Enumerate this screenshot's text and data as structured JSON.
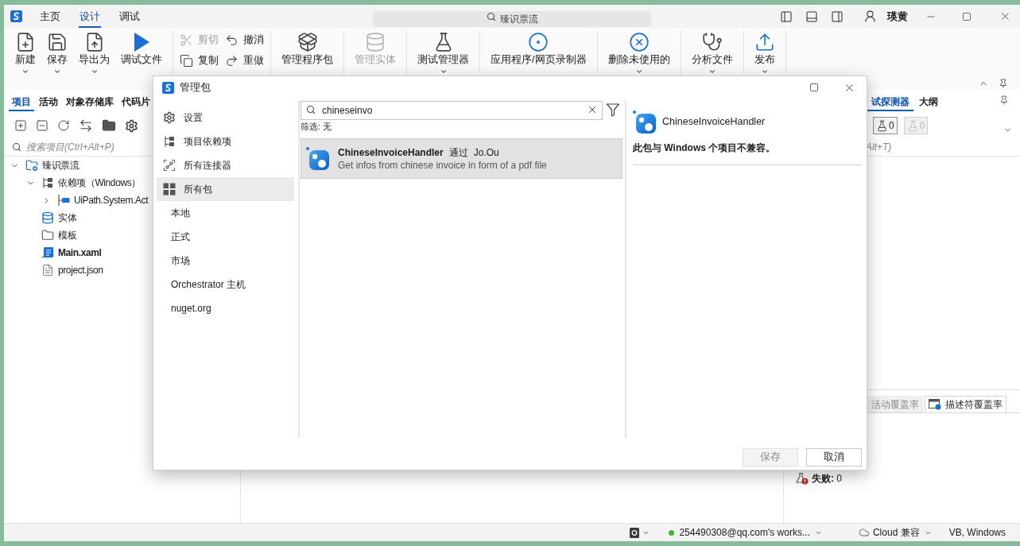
{
  "title_bar": {
    "tabs": [
      {
        "label": "主页",
        "selected": false
      },
      {
        "label": "设计",
        "selected": true
      },
      {
        "label": "调试",
        "selected": false
      }
    ],
    "search": {
      "placeholder": "臻识票流"
    },
    "user": "瑛黄"
  },
  "ribbon": [
    {
      "buttons": [
        {
          "kind": "large",
          "label": "新建",
          "dropdown": true,
          "disabled": false
        },
        {
          "kind": "large",
          "label": "保存",
          "dropdown": true,
          "disabled": false
        },
        {
          "kind": "large",
          "label": "导出为",
          "dropdown": true,
          "disabled": false
        },
        {
          "kind": "large",
          "label": "调试文件",
          "dropdown": false,
          "disabled": false
        }
      ]
    },
    {
      "buttons": [
        {
          "kind": "stack",
          "items": [
            {
              "label": "剪切",
              "disabled": true
            },
            {
              "label": "复制",
              "disabled": false
            }
          ]
        },
        {
          "kind": "stack",
          "items": [
            {
              "label": "撤消",
              "disabled": false
            },
            {
              "label": "重做",
              "disabled": false
            }
          ]
        }
      ]
    },
    {
      "buttons": [
        {
          "kind": "large",
          "label": "管理程序包",
          "dropdown": false,
          "disabled": false
        }
      ]
    },
    {
      "buttons": [
        {
          "kind": "large",
          "label": "管理实体",
          "dropdown": false,
          "disabled": true
        }
      ]
    },
    {
      "buttons": [
        {
          "kind": "large",
          "label": "测试管理器",
          "dropdown": true,
          "disabled": false
        }
      ]
    },
    {
      "buttons": [
        {
          "kind": "large",
          "label": "应用程序/网页录制器",
          "dropdown": false,
          "disabled": false
        }
      ]
    },
    {
      "buttons": [
        {
          "kind": "large",
          "label": "删除未使用的",
          "dropdown": true,
          "disabled": false
        }
      ]
    },
    {
      "buttons": [
        {
          "kind": "large",
          "label": "分析文件",
          "dropdown": true,
          "disabled": false
        }
      ]
    },
    {
      "buttons": [
        {
          "kind": "large",
          "label": "发布",
          "dropdown": true,
          "disabled": false
        }
      ]
    }
  ],
  "project_panel": {
    "tabs": [
      {
        "label": "项目",
        "selected": true
      },
      {
        "label": "活动",
        "selected": false
      },
      {
        "label": "对象存储库",
        "selected": false
      },
      {
        "label": "代码片",
        "selected": false
      }
    ],
    "search": {
      "placeholder": "搜索项目(Ctrl+Alt+P)"
    },
    "tree": [
      {
        "kind": "project",
        "label": "臻识票流",
        "expanded": true,
        "main": false,
        "children": [
          {
            "kind": "dependencies",
            "label": "依赖项（Windows）",
            "expanded": true,
            "main": false,
            "children": [
              {
                "kind": "package",
                "label": "UiPath.System.Act",
                "expanded": false,
                "main": false
              }
            ]
          },
          {
            "kind": "entities",
            "label": "实体",
            "main": false
          },
          {
            "kind": "folder",
            "label": "模板",
            "main": false
          },
          {
            "kind": "workflow",
            "label": "Main.xaml",
            "main": true
          },
          {
            "kind": "file",
            "label": "project.json",
            "main": false
          }
        ]
      }
    ]
  },
  "test_panel": {
    "tabs": [
      {
        "label": "试探测器",
        "selected": true
      },
      {
        "label": "大纲",
        "selected": false
      }
    ],
    "counters": [
      {
        "value": "0",
        "disabled": false
      },
      {
        "value": "0",
        "disabled": true
      }
    ],
    "search": {
      "placeholder": "Alt+T)"
    },
    "coverage_tabs": [
      {
        "label": "活动覆盖率",
        "selected": false
      },
      {
        "label": "描述符覆盖率",
        "selected": true
      }
    ],
    "results": [
      {
        "text": "**失败:** 0"
      }
    ]
  },
  "status_bar": {
    "workspace": {
      "label": "254490308@qq.com's works...",
      "online": true
    },
    "compatibility": "Cloud 兼容",
    "language": "VB, Windows"
  },
  "dialog": {
    "title": "管理包",
    "nav": [
      {
        "kind": "section",
        "label": "设置",
        "selected": false
      },
      {
        "kind": "section",
        "label": "项目依赖项",
        "selected": false
      },
      {
        "kind": "section",
        "label": "所有连接器",
        "selected": false
      },
      {
        "kind": "section",
        "label": "所有包",
        "selected": true
      },
      {
        "kind": "source",
        "label": "本地",
        "selected": false
      },
      {
        "kind": "source",
        "label": "正式",
        "selected": false
      },
      {
        "kind": "source",
        "label": "市场",
        "selected": false
      },
      {
        "kind": "source",
        "label": "Orchestrator 主机",
        "selected": false
      },
      {
        "kind": "source",
        "label": "nuget.org",
        "selected": false
      }
    ],
    "search": {
      "value": "chineseinvo"
    },
    "filter": "筛选: 无",
    "packages": [
      {
        "name": "ChineseInvoiceHandler",
        "author_prefix": "通过",
        "author": "Jo.Ou",
        "description": "Get infos from chinese invoice in form of a pdf file",
        "selected": true
      }
    ],
    "detail": {
      "name": "ChineseInvoiceHandler",
      "message": "此包与 Windows 个项目不兼容。"
    },
    "buttons": [
      {
        "label": "保存",
        "disabled": true
      },
      {
        "label": "取消",
        "disabled": false
      }
    ]
  }
}
